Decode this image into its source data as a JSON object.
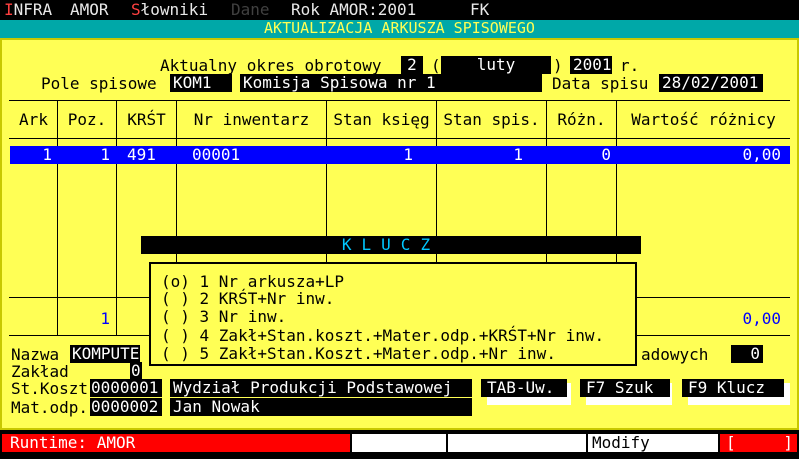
{
  "menu": {
    "items": [
      {
        "label": "INFRA",
        "hot": "I"
      },
      {
        "label": "AMOR"
      },
      {
        "label": "Słowniki",
        "hot": "S"
      },
      {
        "label": "Dane",
        "dim": true
      },
      {
        "label": "Rok AMOR:2001"
      },
      {
        "label": "FK"
      }
    ]
  },
  "title": "AKTUALIZACJA ARKUSZA SPISOWEGO",
  "header": {
    "period_label": "Aktualny okres obrotowy",
    "period_num": "2",
    "paren_open": "(",
    "period_month": "luty",
    "paren_close": ")",
    "year": "2001",
    "year_suffix": "r.",
    "field_label": "Pole spisowe",
    "field_code": "KOM1",
    "field_name": "Komisja Spisowa nr 1",
    "date_label": "Data spisu",
    "date_value": "28/02/2001"
  },
  "table": {
    "columns": [
      "Ark",
      "Poz.",
      "KRŚT",
      "Nr inwentarz",
      "Stan księg",
      "Stan spis.",
      "Różn.",
      "Wartość różnicy"
    ],
    "rows": [
      [
        "1",
        "1",
        "491",
        "00001",
        "1",
        "1",
        "0",
        "0,00"
      ]
    ],
    "totals": {
      "count": "1",
      "value": "0,00"
    }
  },
  "details": {
    "name_label": "Nazwa",
    "name_value": "KOMPUTE",
    "zaklad_label": "Zakład",
    "zaklad_value": "0",
    "stkoszt_label": "St.Koszt",
    "stkoszt_code": "0000001",
    "stkoszt_name": "Wydział Produkcji Podstawowej",
    "matodp_label": "Mat.odp.",
    "matodp_code": "0000002",
    "matodp_name": "Jan Nowak",
    "right_label": "adowych",
    "right_value": "0"
  },
  "buttons": {
    "tab": "TAB-Uw.",
    "f7": "F7 Szuk",
    "f9": "F9 Klucz"
  },
  "klucz": {
    "title": "KLUCZ",
    "options": [
      "(o) 1 Nr arkusza+LP",
      "( ) 2 KRŚT+Nr inw.",
      "( ) 3 Nr inw.",
      "( ) 4 Zakł+Stan.koszt.+Mater.odp.+KRŚT+Nr inw.",
      "( ) 5 Zakł+Stan.Koszt.+Mater.odp.+Nr inw."
    ]
  },
  "status": {
    "runtime": "Runtime: AMOR",
    "mode": "Modify",
    "bracket_open": "[",
    "bracket_close": "]"
  },
  "colors": {
    "panel": "#ffff55",
    "title_bar": "#00a8a8",
    "highlight": "#0000ff",
    "status_red": "#ff0000"
  }
}
